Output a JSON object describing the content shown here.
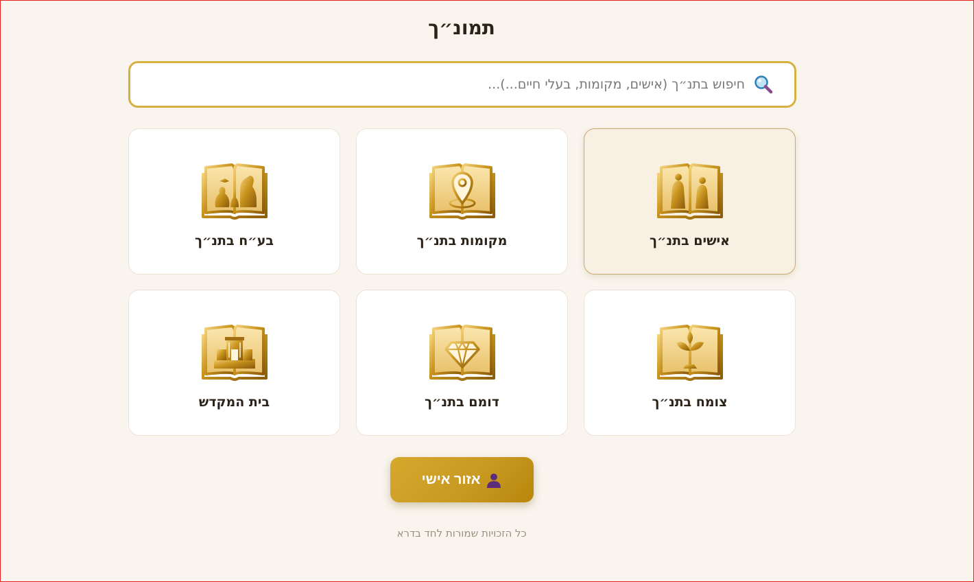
{
  "page": {
    "title": "תמונ״ך"
  },
  "search": {
    "placeholder": "חיפוש בתנ״ך (אישים, מקומות, בעלי חיים...)..."
  },
  "categories": [
    {
      "label": "אישים בתנ״ך",
      "icon": "book-people-icon",
      "active": true
    },
    {
      "label": "מקומות בתנ״ך",
      "icon": "book-location-pin-icon",
      "active": false
    },
    {
      "label": "בע״ח בתנ״ך",
      "icon": "book-animals-icon",
      "active": false
    },
    {
      "label": "צומח בתנ״ך",
      "icon": "book-plant-icon",
      "active": false
    },
    {
      "label": "דומם בתנ״ך",
      "icon": "book-diamond-icon",
      "active": false
    },
    {
      "label": "בית המקדש",
      "icon": "book-temple-icon",
      "active": false
    }
  ],
  "personal_button": {
    "label": "אזור אישי",
    "icon": "user-icon"
  },
  "footer": {
    "text": "כל הזכויות שמורות לחד בדרא"
  },
  "colors": {
    "accent": "#d6b040",
    "gold": "#c99a22",
    "background": "#f9f5ee"
  }
}
